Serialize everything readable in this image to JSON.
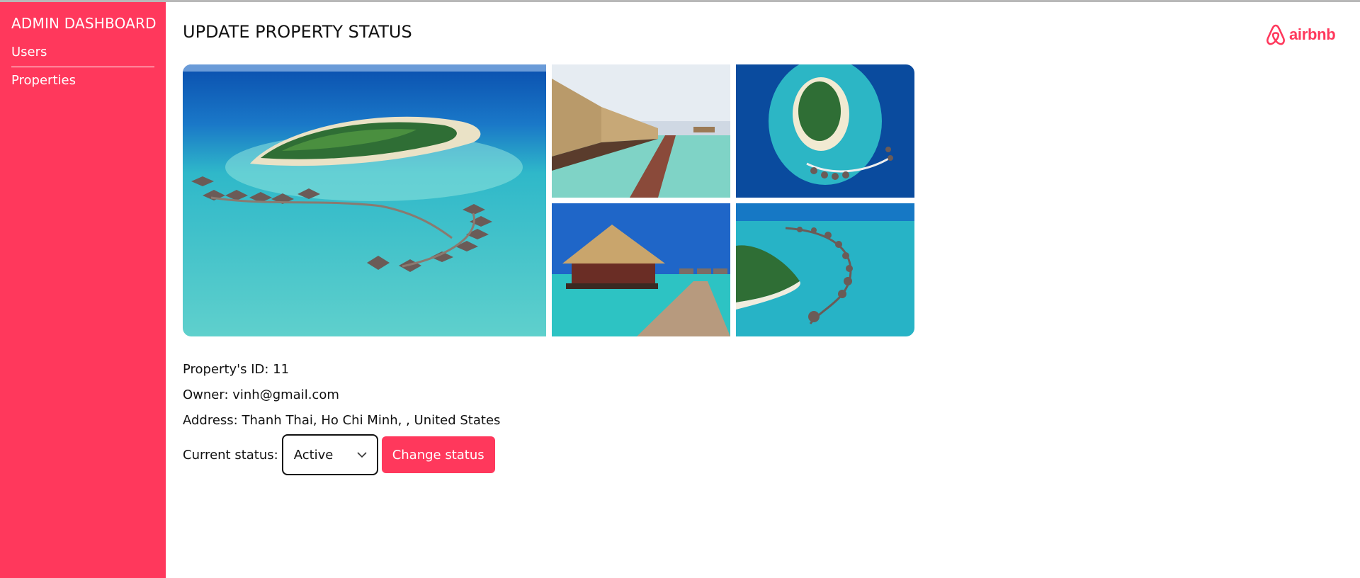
{
  "sidebar": {
    "title": "ADMIN DASHBOARD",
    "items": [
      {
        "label": "Users"
      },
      {
        "label": "Properties"
      }
    ]
  },
  "header": {
    "title": "UPDATE PROPERTY STATUS",
    "logo_text": "airbnb"
  },
  "gallery": {
    "photos": [
      {
        "icon": "island-resort-aerial-photo"
      },
      {
        "icon": "boardwalk-huts-photo"
      },
      {
        "icon": "round-island-aerial-photo"
      },
      {
        "icon": "thatched-hut-pier-photo"
      },
      {
        "icon": "curved-villas-aerial-photo"
      }
    ]
  },
  "property": {
    "id_line": "Property's ID: 11",
    "owner_line": "Owner: vinh@gmail.com",
    "address_line": "Address: Thanh Thai, Ho Chi Minh, , United States"
  },
  "status": {
    "label": "Current status:",
    "selected": "Active",
    "button_label": "Change status"
  },
  "colors": {
    "brand": "#ff385c",
    "sidebar_text": "#ffffff",
    "water": "#3ec8cf",
    "deep_sea": "#0b4fb0"
  }
}
